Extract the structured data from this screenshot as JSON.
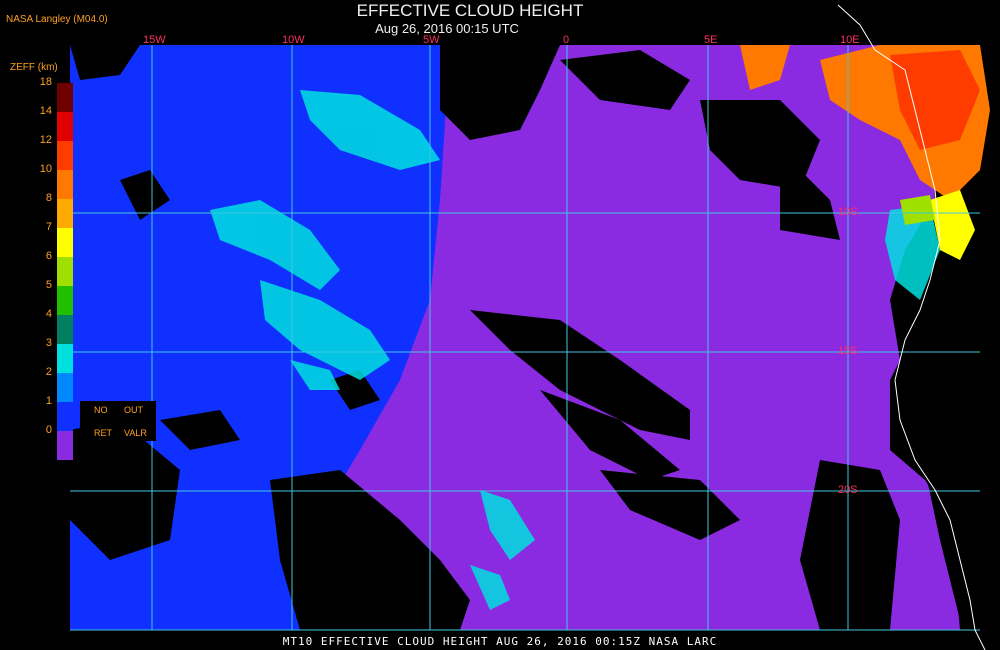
{
  "header": {
    "title": "EFFECTIVE CLOUD HEIGHT",
    "subtitle": "Aug 26, 2016 00:15 UTC",
    "org": "NASA Langley (M04.0)"
  },
  "footer": {
    "caption": "MT10  EFFECTIVE CLOUD HEIGHT   AUG 26, 2016 00:15Z   NASA LARC"
  },
  "legend": {
    "title": "ZEFF (km)",
    "ticks": [
      "18",
      "14",
      "12",
      "10",
      "8",
      "7",
      "6",
      "5",
      "4",
      "3",
      "2",
      "1",
      "0"
    ],
    "colors": [
      "#6e0000",
      "#e00000",
      "#ff3c00",
      "#ff7800",
      "#ffaa00",
      "#ffff00",
      "#a0e000",
      "#20c000",
      "#008060",
      "#00e0e0",
      "#0088ff",
      "#1030ff",
      "#8a2be2"
    ],
    "no_ret": {
      "top": "NO",
      "bottom": "RET",
      "color": "#8a2be2"
    },
    "out_valr": {
      "top": "OUT",
      "bottom": "VALR"
    }
  },
  "map": {
    "lon_labels": [
      "15W",
      "10W",
      "5W",
      "0",
      "5E",
      "10E"
    ],
    "lat_labels": [
      "10S",
      "15S",
      "20S"
    ],
    "colors": {
      "no_retrieval": "#8a2be2",
      "low_cloud": "#1030ff",
      "mid_cloud": "#00e0e0",
      "clear": "#000000",
      "grid": "#40c8e0",
      "coast": "#ffffff"
    }
  }
}
